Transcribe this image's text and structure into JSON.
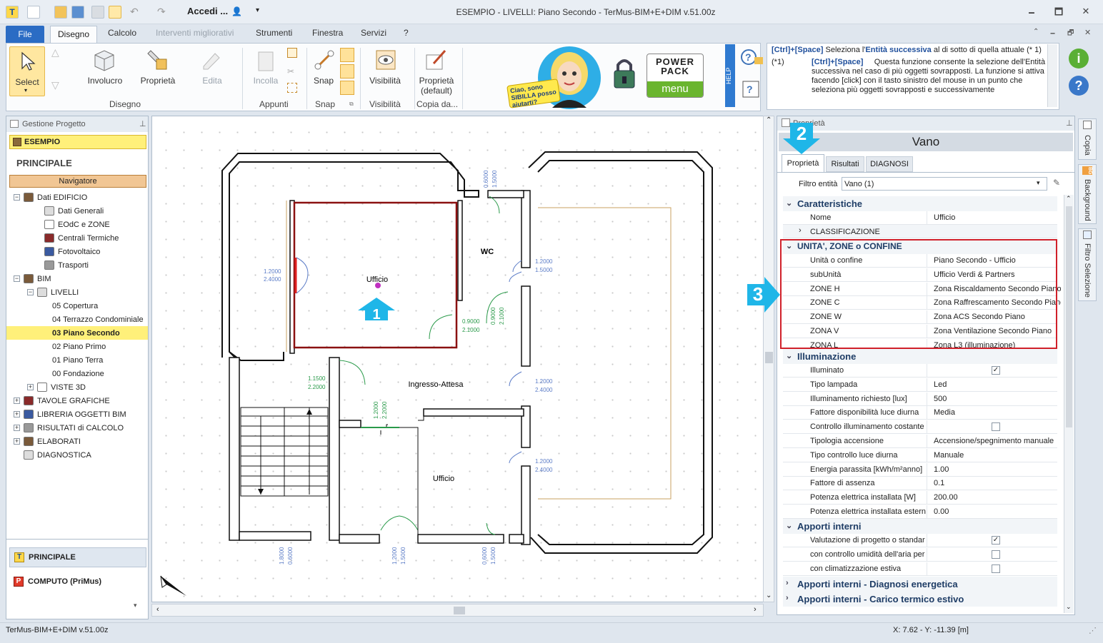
{
  "window": {
    "title": "ESEMPIO -  LIVELLI: Piano Secondo - TerMus-BIM+E+DIM v.51.00z",
    "account_label": "Accedi ...",
    "minimize": "🗕",
    "maximize": "🗖",
    "close": "✕"
  },
  "menu": {
    "file": "File",
    "tabs": [
      "Disegno",
      "Calcolo",
      "Interventi migliorativi",
      "Strumenti",
      "Finestra",
      "Servizi",
      "?"
    ]
  },
  "ribbon": {
    "select": "Select",
    "involucro": "Involucro",
    "proprieta": "Proprietà",
    "edita": "Edita",
    "incolla": "Incolla",
    "snap": "Snap",
    "visibilita": "Visibilità",
    "proprieta_default": "Proprietà\n(default)",
    "groups": [
      "Disegno",
      "Appunti",
      "Snap",
      "Visibilità",
      "Copia da..."
    ],
    "sibilla": "Ciao, sono SIBILLA posso aiutarti?",
    "power_pack_top": "POWER PACK",
    "power_pack_menu": "menu",
    "help_strip": "HELP"
  },
  "help": {
    "line1_key": "[Ctrl]+[Space]",
    "line1_text": " Seleziona l'",
    "line1_bold": "Entità successiva",
    "line1_end": " al di sotto di quella attuale (* 1)",
    "note_marker": "(*1)",
    "note_key": "[Ctrl]+[Space]",
    "note_text": "Questa funzione consente la selezione dell'Entità successiva nel caso di più oggetti sovrapposti. La funzione si attiva facendo [click] con il tasto sinistro del mouse in un punto che seleziona più oggetti sovrapposti e successivamente"
  },
  "left_panel": {
    "header": "Gestione Progetto",
    "project": "ESEMPIO",
    "principale": "PRINCIPALE",
    "navigatore": "Navigatore",
    "tree": [
      {
        "label": "Dati EDIFICIO",
        "level": 0,
        "exp": "−"
      },
      {
        "label": "Dati Generali",
        "level": 1
      },
      {
        "label": "EOdC e ZONE",
        "level": 1
      },
      {
        "label": "Centrali Termiche",
        "level": 1
      },
      {
        "label": "Fotovoltaico",
        "level": 1
      },
      {
        "label": "Trasporti",
        "level": 1
      },
      {
        "label": "BIM",
        "level": 0,
        "exp": "−"
      },
      {
        "label": "LIVELLI",
        "level": 1,
        "exp": "−"
      },
      {
        "label": "05 Copertura",
        "level": 2
      },
      {
        "label": "04 Terrazzo Condominiale",
        "level": 2
      },
      {
        "label": "03 Piano Secondo",
        "level": 2,
        "selected": true
      },
      {
        "label": "02 Piano Primo",
        "level": 2
      },
      {
        "label": "01 Piano Terra",
        "level": 2
      },
      {
        "label": "00 Fondazione",
        "level": 2
      },
      {
        "label": "VISTE 3D",
        "level": 1,
        "exp": "+"
      },
      {
        "label": "TAVOLE GRAFICHE",
        "level": 0,
        "exp": "+"
      },
      {
        "label": "LIBRERIA OGGETTI BIM",
        "level": 0,
        "exp": "+"
      },
      {
        "label": "RISULTATI di CALCOLO",
        "level": 0,
        "exp": "+"
      },
      {
        "label": "ELABORATI",
        "level": 0,
        "exp": "+"
      },
      {
        "label": "DIAGNOSTICA",
        "level": 0
      }
    ],
    "bottom_principale": "PRINCIPALE",
    "bottom_computo": "COMPUTO (PriMus)"
  },
  "plan": {
    "rooms": [
      "Ufficio",
      "WC",
      "Ingresso-Attesa",
      "Ufficio"
    ],
    "dims": [
      "1.2000",
      "2.4000",
      "0.6000",
      "1.5000",
      "1.2000",
      "1.5000",
      "0.9000",
      "2.1000",
      "0.9000",
      "2.1000",
      "1.1500",
      "2.2000",
      "1.2000",
      "2.2000",
      "1.2000",
      "2.4000",
      "1.2000",
      "2.4000",
      "1.8000",
      "0.6000",
      "1.2000",
      "1.5000",
      "0.6000",
      "1.5000"
    ],
    "callout1": "1"
  },
  "right_panel": {
    "header": "Proprietà",
    "entity_title": "Vano",
    "tabs": [
      "Proprietà",
      "Risultati",
      "DIAGNOSI"
    ],
    "filter_label": "Filtro entità",
    "filter_value": "Vano (1)",
    "callout2": "2",
    "callout3": "3",
    "cat_caratteristiche": "Caratteristiche",
    "nome_label": "Nome",
    "nome_value": "Ufficio",
    "classificazione": "CLASSIFICAZIONE",
    "cat_unita": "UNITA', ZONE o CONFINE",
    "unita_rows": [
      {
        "name": "Unità o confine",
        "value": "Piano Secondo - Ufficio"
      },
      {
        "name": "subUnità",
        "value": "Ufficio Verdi & Partners"
      },
      {
        "name": "ZONE H",
        "value": "Zona Riscaldamento Secondo Piano"
      },
      {
        "name": "ZONE C",
        "value": "Zona Raffrescamento Secondo Piano"
      },
      {
        "name": "ZONE W",
        "value": "Zona ACS Secondo Piano"
      },
      {
        "name": "ZONA V",
        "value": "Zona Ventilazione Secondo Piano"
      },
      {
        "name": "ZONA L",
        "value": "Zona L3 (illuminazione)"
      }
    ],
    "cat_illuminazione": "Illuminazione",
    "illum_rows": [
      {
        "name": "Illuminato",
        "value": "",
        "check": "✓"
      },
      {
        "name": "Tipo lampada",
        "value": "Led"
      },
      {
        "name": "Illuminamento richiesto [lux]",
        "value": "500"
      },
      {
        "name": "Fattore disponibilità luce diurna",
        "value": "Media"
      },
      {
        "name": "Controllo illuminamento costante",
        "value": "",
        "check": " "
      },
      {
        "name": "Tipologia accensione",
        "value": "Accensione/spegnimento manuale"
      },
      {
        "name": "Tipo controllo luce diurna",
        "value": "Manuale"
      },
      {
        "name": "Energia parassita [kWh/m²anno]",
        "value": "1.00"
      },
      {
        "name": "Fattore di assenza",
        "value": "0.1"
      },
      {
        "name": "Potenza elettrica installata [W]",
        "value": "200.00"
      },
      {
        "name": "Potenza elettrica installata estern",
        "value": "0.00"
      }
    ],
    "cat_apporti": "Apporti interni",
    "apporti_rows": [
      {
        "name": "Valutazione di progetto o standar",
        "check": "✓"
      },
      {
        "name": "con controllo umidità dell'aria per l",
        "check": " "
      },
      {
        "name": "con climatizzazione estiva",
        "check": " "
      }
    ],
    "cat_diagnosi": "Apporti interni - Diagnosi energetica",
    "cat_carico": "Apporti interni - Carico termico estivo",
    "vtabs": [
      "Copia",
      "Background",
      "Filtro Selezione"
    ]
  },
  "status": {
    "left": "TerMus-BIM+E+DIM v.51.00z",
    "coords": "X: 7.62 - Y: -11.39 [m]"
  },
  "colors": {
    "accent": "#2b6cc4",
    "highlight_red": "#d0202a",
    "callout_cyan": "#1fb6e8",
    "selection_yellow": "#fff07a"
  }
}
